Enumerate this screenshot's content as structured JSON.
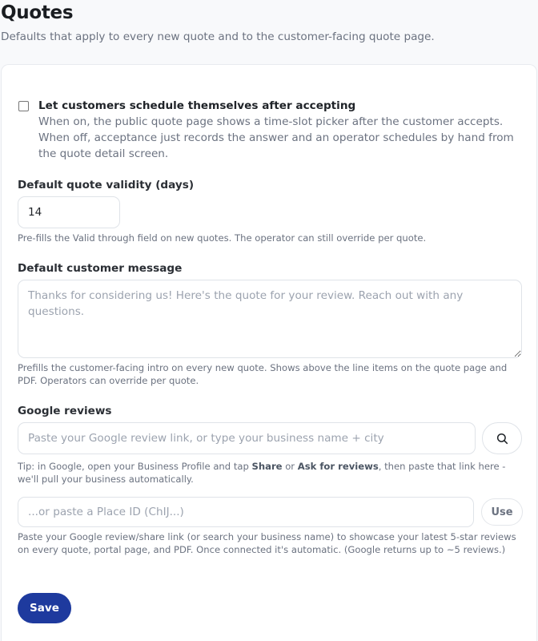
{
  "page": {
    "title": "Quotes",
    "subtitle": "Defaults that apply to every new quote and to the customer-facing quote page."
  },
  "self_schedule": {
    "label": "Let customers schedule themselves after accepting",
    "description": "When on, the public quote page shows a time-slot picker after the customer accepts. When off, acceptance just records the answer and an operator schedules by hand from the quote detail screen.",
    "checked": false
  },
  "validity": {
    "label": "Default quote validity (days)",
    "value": "14",
    "help": "Pre-fills the Valid through field on new quotes. The operator can still override per quote."
  },
  "customer_message": {
    "label": "Default customer message",
    "placeholder": "Thanks for considering us! Here's the quote for your review. Reach out with any questions.",
    "help": "Prefills the customer-facing intro on every new quote. Shows above the line items on the quote page and PDF. Operators can override per quote."
  },
  "google_reviews": {
    "label": "Google reviews",
    "search_placeholder": "Paste your Google review link, or type your business name + city",
    "search_icon": "search-icon",
    "tip_prefix": "Tip: in Google, open your Business Profile and tap ",
    "tip_share": "Share",
    "tip_or": " or ",
    "tip_ask": "Ask for reviews",
    "tip_suffix": ", then paste that link here - we'll pull your business automatically.",
    "place_id_placeholder": "...or paste a Place ID (ChIJ...)",
    "use_label": "Use",
    "help": "Paste your Google review/share link (or search your business name) to showcase your latest 5-star reviews on every quote, portal page, and PDF. Once connected it's automatic. (Google returns up to ~5 reviews.)"
  },
  "actions": {
    "save_label": "Save"
  },
  "colors": {
    "primary": "#1e3a9e",
    "muted_text": "#6b7280",
    "border": "#dfe3e8"
  }
}
